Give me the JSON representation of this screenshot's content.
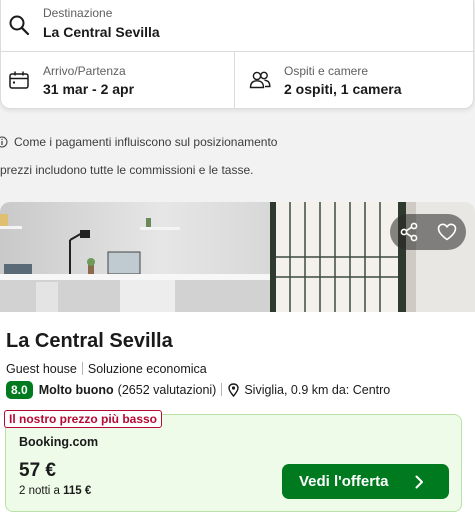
{
  "search": {
    "destination_label": "Destinazione",
    "destination_value": "La Central Sevilla",
    "dates_label": "Arrivo/Partenza",
    "dates_value": "31 mar - 2 apr",
    "guests_label": "Ospiti e camere",
    "guests_value": "2 ospiti, 1 camera"
  },
  "notices": {
    "ranking_info": "Come i pagamenti influiscono sul posizionamento",
    "prices_info": "prezzi includono tutte le commissioni e le tasse."
  },
  "hotel": {
    "name": "La Central Sevilla",
    "type": "Guest house",
    "category": "Soluzione economica",
    "score": "8.0",
    "score_label": "Molto buono",
    "reviews": "(2652 valutazioni)",
    "location": "Siviglia, 0.9 km da: Centro"
  },
  "deal": {
    "badge": "Il nostro prezzo più basso",
    "provider": "Booking.com",
    "price": "57 €",
    "nights_prefix": "2 notti a",
    "nights_total": "115 €",
    "cta": "Vedi l'offerta"
  },
  "colors": {
    "accent_green": "#007a1f",
    "badge_red": "#b40a33",
    "deal_bg": "#edfbe8"
  },
  "icons": [
    "search-icon",
    "calendar-icon",
    "guests-icon",
    "info-icon",
    "share-icon",
    "heart-icon",
    "location-pin-icon",
    "chevron-right-icon"
  ]
}
